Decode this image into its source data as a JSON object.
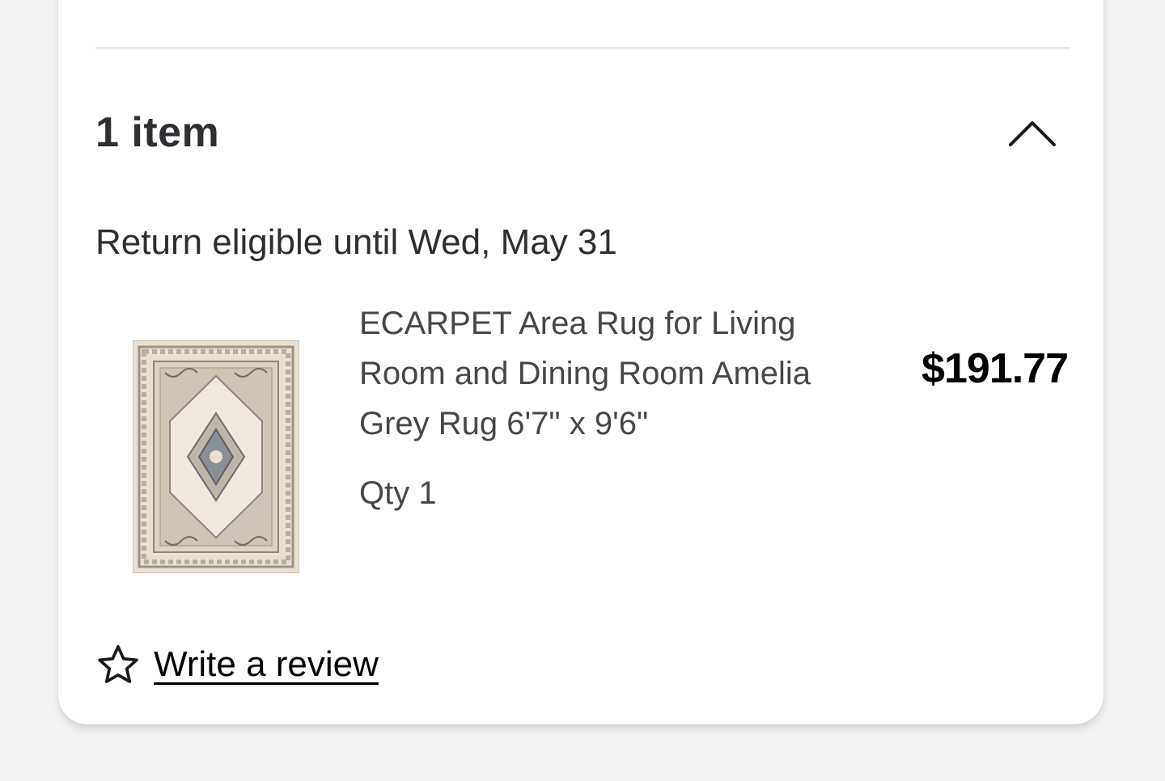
{
  "items_section": {
    "title": "1 item",
    "collapse_icon": "chevron-up-icon"
  },
  "return_info": {
    "text": "Return eligible until Wed, May 31"
  },
  "product": {
    "name": "ECARPET Area Rug for Living Room and Dining Room  Amelia Grey Rug 6'7\" x 9'6\"",
    "qty": "Qty 1",
    "price": "$191.77",
    "image_icon": "rug-image"
  },
  "review": {
    "label": "Write a review",
    "icon": "star-outline-icon"
  },
  "colors": {
    "text_primary": "#2e2f32",
    "price": "#000000",
    "divider": "#e6e7e8",
    "rug_base": "#e9dfd3",
    "rug_pattern": "#8a8580"
  }
}
